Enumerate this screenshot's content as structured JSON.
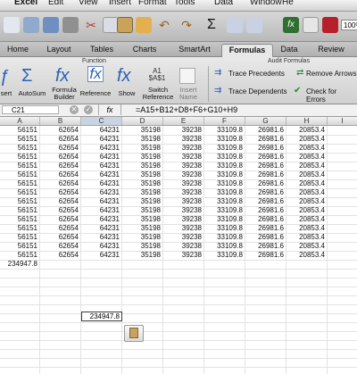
{
  "menubar": {
    "app": "Excel",
    "items": [
      "File",
      "Edit",
      "View",
      "Insert",
      "Format",
      "Tools",
      "Data",
      "Window",
      "He"
    ]
  },
  "toolbar": {
    "zoom": "100%",
    "icons": [
      "new-icon",
      "open-icon",
      "save-icon",
      "print-icon",
      "cut-icon",
      "copy-icon",
      "paste-icon",
      "format-painter-icon",
      "undo-icon",
      "redo-icon",
      "autosum-icon",
      "sort-icon",
      "filter-icon",
      "function-icon",
      "gallery-icon",
      "toolbox-icon"
    ]
  },
  "tabs": [
    "Home",
    "Layout",
    "Tables",
    "Charts",
    "SmartArt",
    "Formulas",
    "Data",
    "Review"
  ],
  "active_tab": "Formulas",
  "ribbon": {
    "group_function": "Function",
    "group_audit": "Audit Formulas",
    "buttons": [
      "sert",
      "AutoSum",
      "Formula\nBuilder",
      "Reference",
      "Show",
      "Switch\nReference",
      "Insert\nName"
    ],
    "switch_glyph": "A1\n$A$1",
    "audit": {
      "trace_precedents": "Trace Precedents",
      "trace_dependents": "Trace Dependents",
      "remove_arrows": "Remove Arrows",
      "check_errors": "Check for Errors"
    }
  },
  "formula_bar": {
    "name_box": "C21",
    "fx_label": "fx",
    "formula": "=A15+B12+D8+F6+G10+H9"
  },
  "columns": [
    "A",
    "B",
    "C",
    "D",
    "E",
    "F",
    "G",
    "H",
    "I"
  ],
  "selected_column": "C",
  "rows": [
    [
      "56151",
      "62654",
      "64231",
      "35198",
      "39238",
      "33109.8",
      "26981.6",
      "20853.4"
    ],
    [
      "56151",
      "62654",
      "64231",
      "35198",
      "39238",
      "33109.8",
      "26981.6",
      "20853.4"
    ],
    [
      "56151",
      "62654",
      "64231",
      "35198",
      "39238",
      "33109.8",
      "26981.6",
      "20853.4"
    ],
    [
      "56151",
      "62654",
      "64231",
      "35198",
      "39238",
      "33109.8",
      "26981.6",
      "20853.4"
    ],
    [
      "56151",
      "62654",
      "64231",
      "35198",
      "39238",
      "33109.8",
      "26981.6",
      "20853.4"
    ],
    [
      "56151",
      "62654",
      "64231",
      "35198",
      "39238",
      "33109.8",
      "26981.6",
      "20853.4"
    ],
    [
      "56151",
      "62654",
      "64231",
      "35198",
      "39238",
      "33109.8",
      "26981.6",
      "20853.4"
    ],
    [
      "56151",
      "62654",
      "64231",
      "35198",
      "39238",
      "33109.8",
      "26981.6",
      "20853.4"
    ],
    [
      "56151",
      "62654",
      "64231",
      "35198",
      "39238",
      "33109.8",
      "26981.6",
      "20853.4"
    ],
    [
      "56151",
      "62654",
      "64231",
      "35198",
      "39238",
      "33109.8",
      "26981.6",
      "20853.4"
    ],
    [
      "56151",
      "62654",
      "64231",
      "35198",
      "39238",
      "33109.8",
      "26981.6",
      "20853.4"
    ],
    [
      "56151",
      "62654",
      "64231",
      "35198",
      "39238",
      "33109.8",
      "26981.6",
      "20853.4"
    ],
    [
      "56151",
      "62654",
      "64231",
      "35198",
      "39238",
      "33109.8",
      "26981.6",
      "20853.4"
    ],
    [
      "56151",
      "62654",
      "64231",
      "35198",
      "39238",
      "33109.8",
      "26981.6",
      "20853.4"
    ],
    [
      "56151",
      "62654",
      "64231",
      "35198",
      "39238",
      "33109.8",
      "26981.6",
      "20853.4"
    ],
    [
      "234947.8",
      "",
      "",
      "",
      "",
      "",
      "",
      ""
    ]
  ],
  "selected_cell_value": "234947.8"
}
